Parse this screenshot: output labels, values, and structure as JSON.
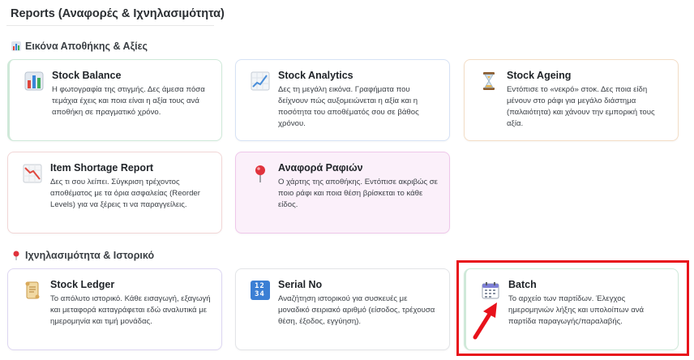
{
  "page": {
    "title": "Reports (Αναφορές & Ιχνηλασιμότητα)"
  },
  "sections": [
    {
      "title": "Εικόνα Αποθήκης & Αξίες",
      "icon": "bar-chart-icon"
    },
    {
      "title": "Ιχνηλασιμότητα & Ιστορικό",
      "icon": "pushpin-icon"
    }
  ],
  "cards": {
    "stock_balance": {
      "title": "Stock Balance",
      "desc": "Η φωτογραφία της στιγμής. Δες άμεσα πόσα τεμάχια έχεις και ποια είναι η αξία τους ανά αποθήκη σε πραγματικό χρόνο.",
      "icon": "bar-chart-icon"
    },
    "stock_analytics": {
      "title": "Stock Analytics",
      "desc": "Δες τη μεγάλη εικόνα. Γραφήματα που δείχνουν πώς αυξομειώνεται η αξία και η ποσότητα του αποθέματός σου σε βάθος χρόνου.",
      "icon": "chart-increasing-icon"
    },
    "stock_ageing": {
      "title": "Stock Ageing",
      "desc": "Εντόπισε το «νεκρό» στοκ. Δες ποια είδη μένουν στο ράφι για μεγάλο διάστημα (παλαιότητα) και χάνουν την εμπορική τους αξία.",
      "icon": "hourglass-icon"
    },
    "item_shortage": {
      "title": "Item Shortage Report",
      "desc": "Δες τι σου λείπει. Σύγκριση τρέχοντος αποθέματος με τα όρια ασφαλείας (Reorder Levels) για να ξέρεις τι να παραγγείλεις.",
      "icon": "chart-decreasing-icon"
    },
    "shelf_report": {
      "title": "Αναφορά Ραφιών",
      "desc": "Ο χάρτης της αποθήκης. Εντόπισε ακριβώς σε ποιο ράφι και ποια θέση βρίσκεται το κάθε είδος.",
      "icon": "round-pushpin-icon"
    },
    "stock_ledger": {
      "title": "Stock Ledger",
      "desc": "Το απόλυτο ιστορικό. Κάθε εισαγωγή, εξαγωγή και μεταφορά καταγράφεται εδώ αναλυτικά με ημερομηνία και τιμή μονάδας.",
      "icon": "scroll-icon"
    },
    "serial_no": {
      "title": "Serial No",
      "desc": "Αναζήτηση ιστορικού για συσκευές με μοναδικό σειριακό αριθμό (είσοδος, τρέχουσα θέση, έξοδος, εγγύηση).",
      "icon": "numbers-1234-icon",
      "icon_text": "1234"
    },
    "batch": {
      "title": "Batch",
      "desc": "Το αρχείο των παρτίδων. Έλεγχος ημερομηνιών λήξης και υπολοίπων ανά παρτίδα παραγωγής/παραλαβής.",
      "icon": "calendar-icon"
    }
  },
  "annotation": {
    "highlight_color": "#e8121b",
    "target": "batch"
  }
}
